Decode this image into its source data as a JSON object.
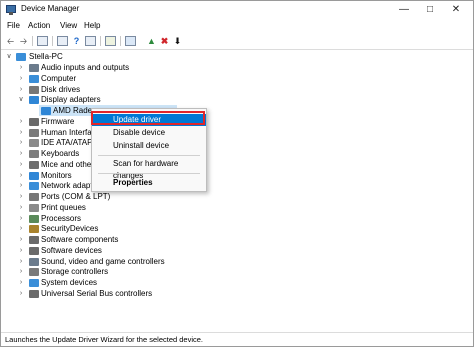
{
  "window": {
    "title": "Device Manager"
  },
  "menu": [
    "File",
    "Action",
    "View",
    "Help"
  ],
  "tree": {
    "root": "Stella-PC",
    "items": [
      {
        "label": "Audio inputs and outputs",
        "icon": "speaker-icon",
        "color": "#6b7b8c"
      },
      {
        "label": "Computer",
        "icon": "computer-icon",
        "color": "#3a8ed8"
      },
      {
        "label": "Disk drives",
        "icon": "disk-icon",
        "color": "#777777"
      },
      {
        "label": "Display adapters",
        "icon": "display-icon",
        "color": "#2f86d6",
        "expanded": true
      },
      {
        "label": "AMD Radeon",
        "icon": "display-icon",
        "color": "#2f86d6",
        "child": true,
        "selected": true
      },
      {
        "label": "Firmware",
        "icon": "chip-icon",
        "color": "#6a6a6a"
      },
      {
        "label": "Human Interface",
        "icon": "hid-icon",
        "color": "#7a7a7a"
      },
      {
        "label": "IDE ATA/ATAPI c",
        "icon": "ide-icon",
        "color": "#8a8a8a"
      },
      {
        "label": "Keyboards",
        "icon": "keyboard-icon",
        "color": "#7d7d7d"
      },
      {
        "label": "Mice and other",
        "icon": "mouse-icon",
        "color": "#6d6d6d"
      },
      {
        "label": "Monitors",
        "icon": "monitor-icon",
        "color": "#2f86d6"
      },
      {
        "label": "Network adapte",
        "icon": "network-icon",
        "color": "#3a8ed8"
      },
      {
        "label": "Ports (COM & LPT)",
        "icon": "port-icon",
        "color": "#777777"
      },
      {
        "label": "Print queues",
        "icon": "printer-icon",
        "color": "#8a8a8a"
      },
      {
        "label": "Processors",
        "icon": "cpu-icon",
        "color": "#5a8a5a"
      },
      {
        "label": "SecurityDevices",
        "icon": "security-icon",
        "color": "#a9832d"
      },
      {
        "label": "Software components",
        "icon": "component-icon",
        "color": "#6a6a6a"
      },
      {
        "label": "Software devices",
        "icon": "software-device-icon",
        "color": "#6a6a6a"
      },
      {
        "label": "Sound, video and game controllers",
        "icon": "sound-icon",
        "color": "#6b7b8c"
      },
      {
        "label": "Storage controllers",
        "icon": "storage-icon",
        "color": "#7a7a7a"
      },
      {
        "label": "System devices",
        "icon": "system-icon",
        "color": "#3a8ed8"
      },
      {
        "label": "Universal Serial Bus controllers",
        "icon": "usb-icon",
        "color": "#6a6a6a"
      }
    ]
  },
  "context_menu": {
    "items": [
      "Update driver",
      "Disable device",
      "Uninstall device",
      "Scan for hardware changes",
      "Properties"
    ],
    "highlighted": "Update driver"
  },
  "status": "Launches the Update Driver Wizard for the selected device."
}
